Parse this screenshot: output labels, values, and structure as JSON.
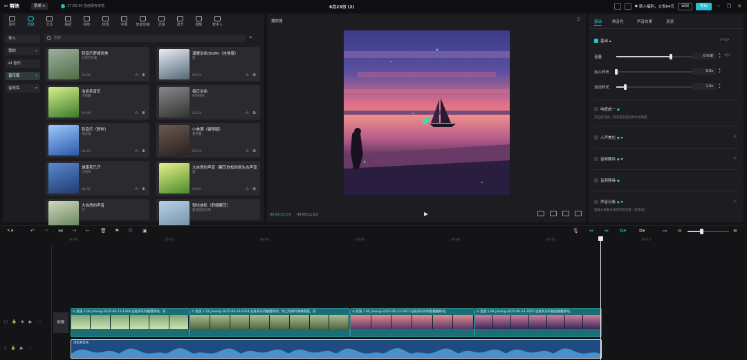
{
  "app": {
    "logo": "剪映",
    "menu": "菜单",
    "autosave": "17:56:35 自动保存本地",
    "doc_title": "6月23日 (2)",
    "promo": "新人福利，立省84元",
    "member_btn": "审阅",
    "export_btn": "导出",
    "colors": {
      "accent": "#1fc8d4",
      "bg": "#141417",
      "panel": "#1d1d21"
    }
  },
  "tools": [
    {
      "label": "素材",
      "icon": "media-icon"
    },
    {
      "label": "音频",
      "icon": "audio-icon",
      "active": true
    },
    {
      "label": "文本",
      "icon": "text-icon"
    },
    {
      "label": "贴纸",
      "icon": "sticker-icon"
    },
    {
      "label": "特效",
      "icon": "effects-icon"
    },
    {
      "label": "转场",
      "icon": "transition-icon"
    },
    {
      "label": "字幕",
      "icon": "subtitle-icon"
    },
    {
      "label": "智能包装",
      "icon": "smart-package-icon"
    },
    {
      "label": "滤镜",
      "icon": "filter-icon"
    },
    {
      "label": "调节",
      "icon": "adjust-icon"
    },
    {
      "label": "模板",
      "icon": "template-icon"
    },
    {
      "label": "数字人",
      "icon": "digital-human-icon"
    }
  ],
  "categories": [
    {
      "label": "导入",
      "chev": ""
    },
    {
      "label": "我的",
      "chev": "▾"
    },
    {
      "label": "AI 音乐",
      "chev": ""
    },
    {
      "label": "音乐库",
      "chev": "▾",
      "active": true
    },
    {
      "label": "音效库",
      "chev": "▾"
    }
  ],
  "search": {
    "placeholder": "治愈"
  },
  "cards": [
    {
      "title": "轻音乐舒缓优美",
      "artist": "治愈音乐集",
      "duration": "01:00"
    },
    {
      "title": "温暖治愈(BGM)（吉他版）",
      "artist": "莫",
      "duration": "00:52"
    },
    {
      "title": "治愈系音乐",
      "artist": "夕暖暖",
      "duration": "00:40"
    },
    {
      "title": "每日治愈",
      "artist": "阿布德有",
      "duration": "01:24"
    },
    {
      "title": "轻音乐（舒伴）",
      "artist": "阳光喵",
      "duration": "02:23"
    },
    {
      "title": "小美满（钢琴版）",
      "artist": "夏特露",
      "duration": "03:33"
    },
    {
      "title": "城南花已开",
      "artist": "三亩地",
      "duration": "04:31"
    },
    {
      "title": "大自然的声音（解压放松的原生态声音）",
      "artist": "晨",
      "duration": "01:00"
    },
    {
      "title": "大自然的声音",
      "artist": "沉",
      "duration": ""
    },
    {
      "title": "轻松放松（舒缓解压）",
      "artist": "解压放松治愈",
      "duration": ""
    }
  ],
  "player": {
    "title": "播放器",
    "time_current": "00:00:11:03",
    "time_total": "00:00:11:03"
  },
  "props": {
    "tabs": [
      "基础",
      "换音色",
      "声音效果",
      "变速"
    ],
    "section_basic": "基础",
    "volume_label": "音量",
    "volume_value": "0.0dB",
    "volume_level": 0.72,
    "fadein_label": "淡入时长",
    "fadein_value": "0.0s",
    "fadein_level": 0.0,
    "fadeout_label": "淡出时长",
    "fadeout_value": "1.0s",
    "fadeout_level": 0.12,
    "loudness_label": "响度统一",
    "loudness_desc": "开启后可统一所选或多选的原片段响度",
    "voice_beautify_label": "人声美化",
    "audio_translate_label": "音频翻译",
    "noise_reduce_label": "音频降噪",
    "voice_separate_label": "声音分离",
    "voice_separate_desc": "选择分离要分离的声音元素（可多选）"
  },
  "timeline": {
    "ticks": [
      "00:00",
      "00:02",
      "00:04",
      "00:06",
      "00:08",
      "00:10",
      "00:12"
    ],
    "cover_label": "封面",
    "video_clips": [
      {
        "label": "⊙ 变速 2.0X  jimeng-2025-06-23-4789-远处风车的缓慢转动，有"
      },
      {
        "label": "⊙ 变速 1.5X  jimeng-2025-06-23-6324-远处风车的缓慢转动，树上的树叶微微摇摆，前"
      },
      {
        "label": "⊙ 变速 1.9X  jimeng-2025-06-23-5957-远处风车的帆船缓缓移动，"
      },
      {
        "label": "⊙ 变速 1.9X  jimeng-2025-06-23-7607-远处风车的帆船缓缓移动，"
      }
    ],
    "audio_clip": "治愈系音乐"
  }
}
